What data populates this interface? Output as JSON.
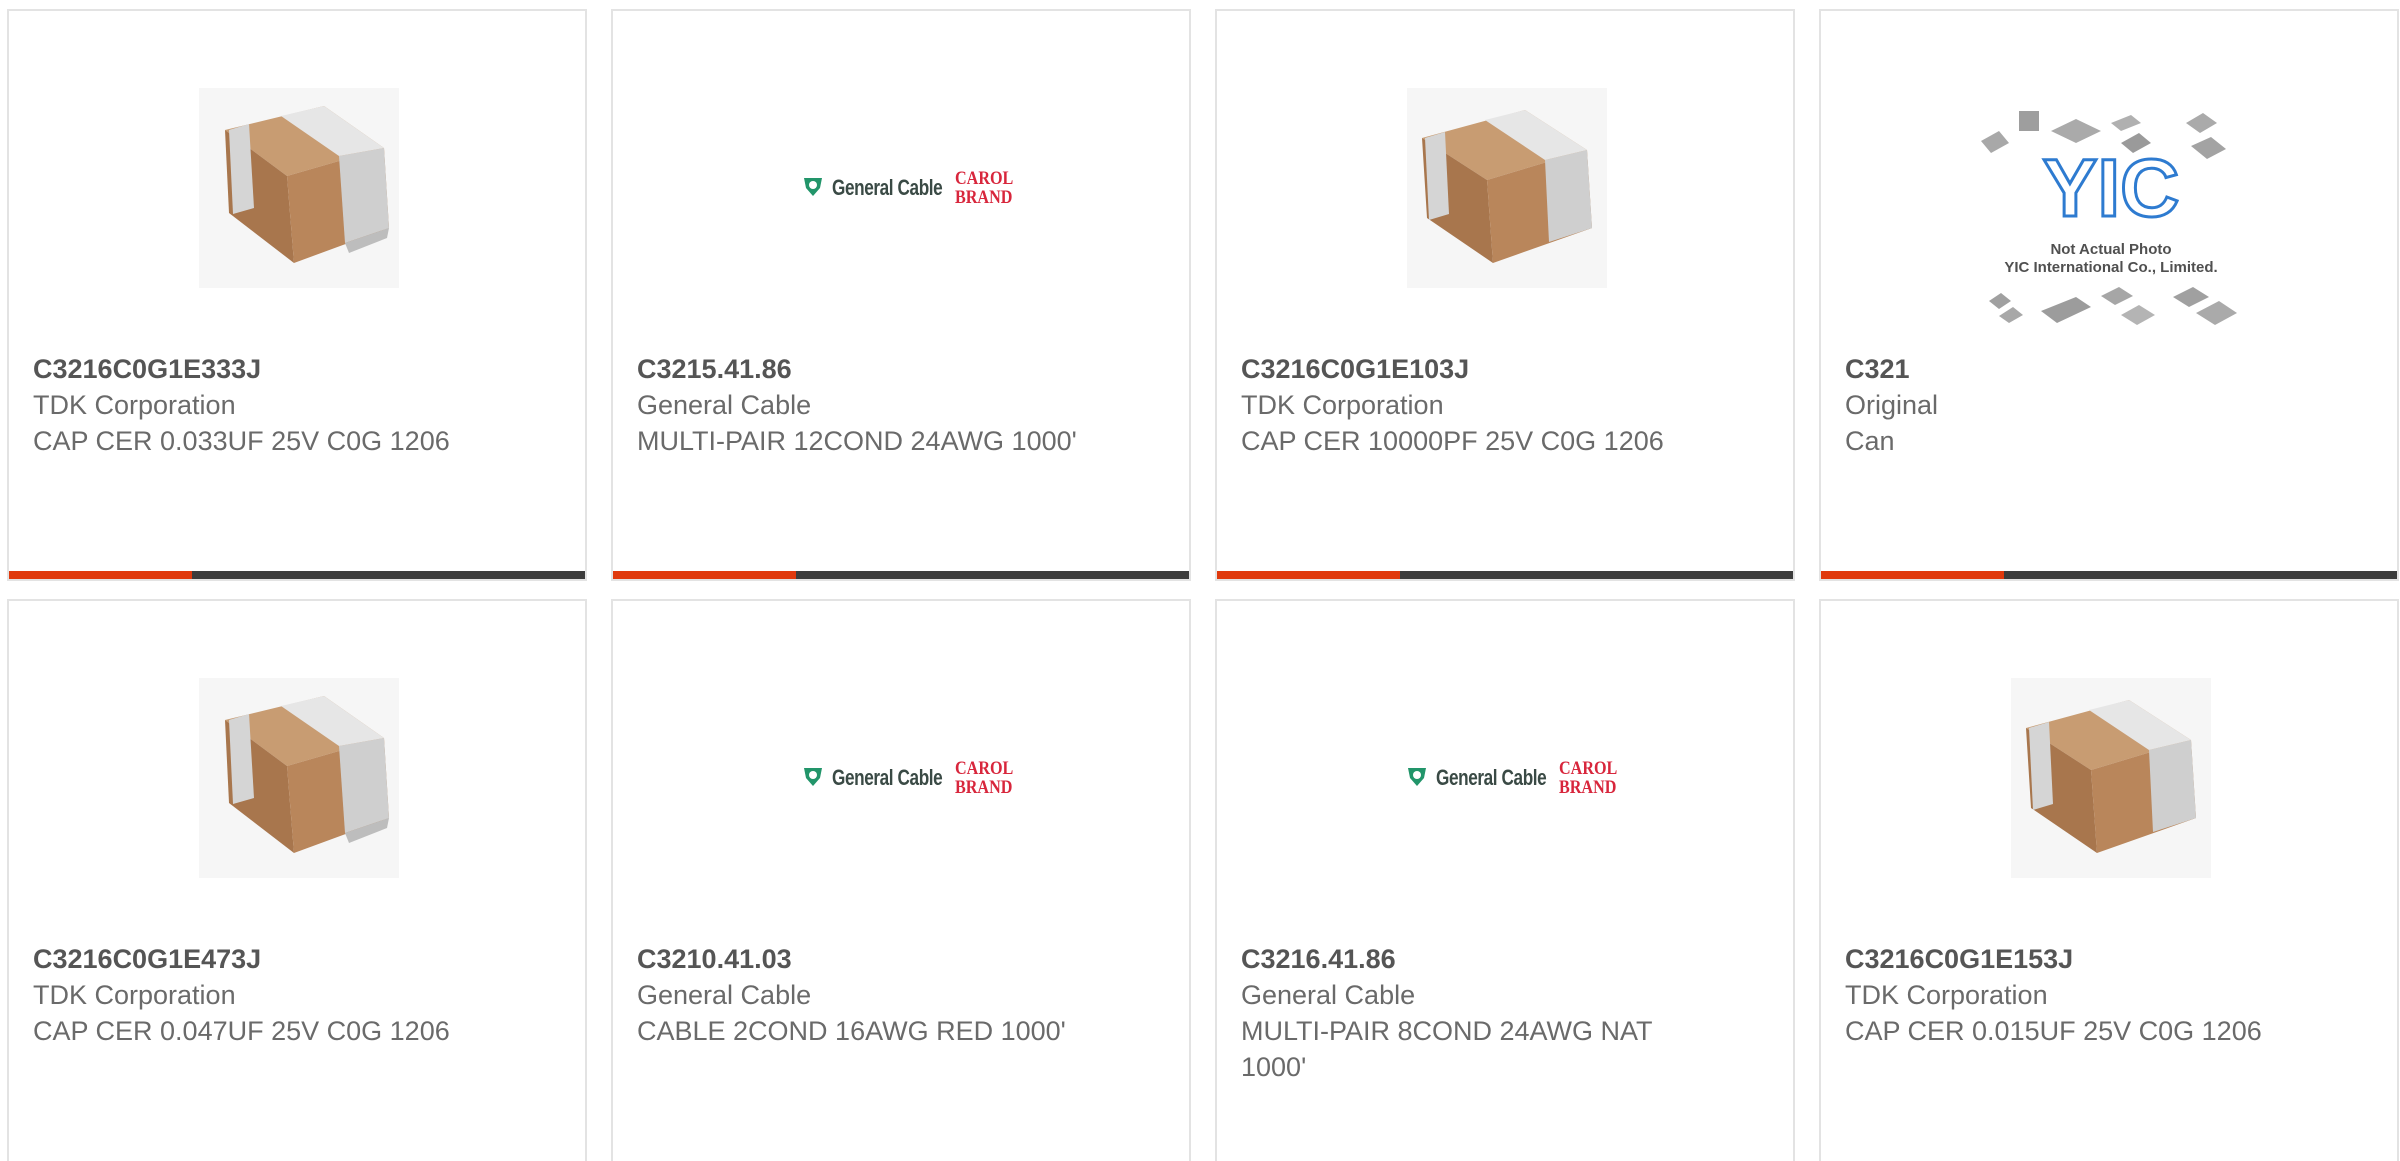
{
  "products": [
    {
      "part_number": "C3216C0G1E333J",
      "manufacturer": "TDK Corporation",
      "description": "CAP CER 0.033UF 25V C0G 1206",
      "image": "capacitor-chip"
    },
    {
      "part_number": "C3215.41.86",
      "manufacturer": "General Cable",
      "description": "MULTI-PAIR 12COND 24AWG 1000'",
      "image": "general-cable-logo"
    },
    {
      "part_number": "C3216C0G1E103J",
      "manufacturer": "TDK Corporation",
      "description": "CAP CER 10000PF 25V C0G 1206",
      "image": "capacitor-chip"
    },
    {
      "part_number": "C321",
      "manufacturer": "Original",
      "description": "Can",
      "image": "yic-placeholder"
    },
    {
      "part_number": "C3216C0G1E473J",
      "manufacturer": "TDK Corporation",
      "description": "CAP CER 0.047UF 25V C0G 1206",
      "image": "capacitor-chip"
    },
    {
      "part_number": "C3210.41.03",
      "manufacturer": "General Cable",
      "description": "CABLE 2COND 16AWG RED 1000'",
      "image": "general-cable-logo"
    },
    {
      "part_number": "C3216.41.86",
      "manufacturer": "General Cable",
      "description": "MULTI-PAIR 8COND 24AWG NAT 1000'",
      "image": "general-cable-logo"
    },
    {
      "part_number": "C3216C0G1E153J",
      "manufacturer": "TDK Corporation",
      "description": "CAP CER 0.015UF 25V C0G 1206",
      "image": "capacitor-chip"
    }
  ],
  "logos": {
    "general_cable_text": "General Cable",
    "carol_line1": "CAROL",
    "carol_line2": "BRAND",
    "yic_mark": "YIC",
    "yic_note_line1": "Not Actual Photo",
    "yic_note_line2": "YIC International Co., Limited."
  },
  "colors": {
    "accent": "#e0390d",
    "bar": "#3c3c3c",
    "border": "#e3e3e3",
    "text": "#6a6a6a"
  }
}
